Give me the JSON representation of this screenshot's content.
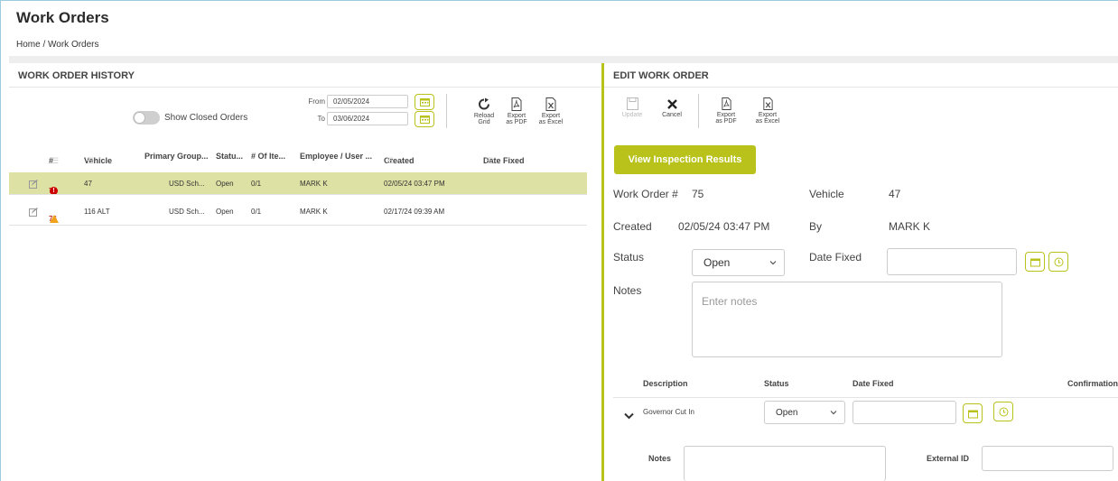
{
  "page": {
    "title": "Work Orders",
    "breadcrumb": "Home / Work Orders"
  },
  "history": {
    "title": "WORK ORDER HISTORY",
    "show_closed_label": "Show Closed Orders",
    "from_label": "From",
    "from_value": "02/05/2024",
    "to_label": "To",
    "to_value": "03/06/2024",
    "reload_label_1": "Reload",
    "reload_label_2": "Grid",
    "export_pdf_1": "Export",
    "export_pdf_2": "as PDF",
    "export_excel_1": "Export",
    "export_excel_2": "as Excel",
    "columns": {
      "num": "#",
      "vehicle": "Vehicle",
      "group": "Primary Group...",
      "status": "Statu...",
      "items": "# Of Ite...",
      "employee": "Employee / User ...",
      "created": "Created",
      "date_fixed": "Date Fixed"
    },
    "rows": [
      {
        "num": "75",
        "badge": "!",
        "vehicle": "47",
        "group": "USD Sch...",
        "status": "Open",
        "items": "0/1",
        "employee": "MARK K",
        "created": "02/05/24 03:47 PM",
        "date_fixed": ""
      },
      {
        "num": "76",
        "badge": "",
        "vehicle": "116 ALT",
        "group": "USD Sch...",
        "status": "Open",
        "items": "0/1",
        "employee": "MARK K",
        "created": "02/17/24 09:39 AM",
        "date_fixed": ""
      }
    ]
  },
  "edit": {
    "title": "EDIT WORK ORDER",
    "update_label": "Update",
    "cancel_label": "Cancel",
    "export_pdf_1": "Export",
    "export_pdf_2": "as PDF",
    "export_excel_1": "Export",
    "export_excel_2": "as Excel",
    "view_inspection": "View Inspection Results",
    "work_order_label": "Work Order #",
    "work_order_value": "75",
    "vehicle_label": "Vehicle",
    "vehicle_value": "47",
    "created_label": "Created",
    "created_value": "02/05/24 03:47 PM",
    "by_label": "By",
    "by_value": "MARK K",
    "status_label": "Status",
    "status_value": "Open",
    "date_fixed_label": "Date Fixed",
    "notes_label": "Notes",
    "notes_placeholder": "Enter notes",
    "tasks_header": {
      "description": "Description",
      "status": "Status",
      "date_fixed": "Date Fixed",
      "confirmation": "Confirmation"
    },
    "task": {
      "description": "Governor Cut In",
      "status": "Open"
    },
    "task_notes_label": "Notes",
    "external_id_label": "External ID"
  },
  "colors": {
    "accent": "#b9c21a",
    "selected_row": "#dde1a3",
    "alert": "#cc0000",
    "warning": "#f0a21a"
  }
}
